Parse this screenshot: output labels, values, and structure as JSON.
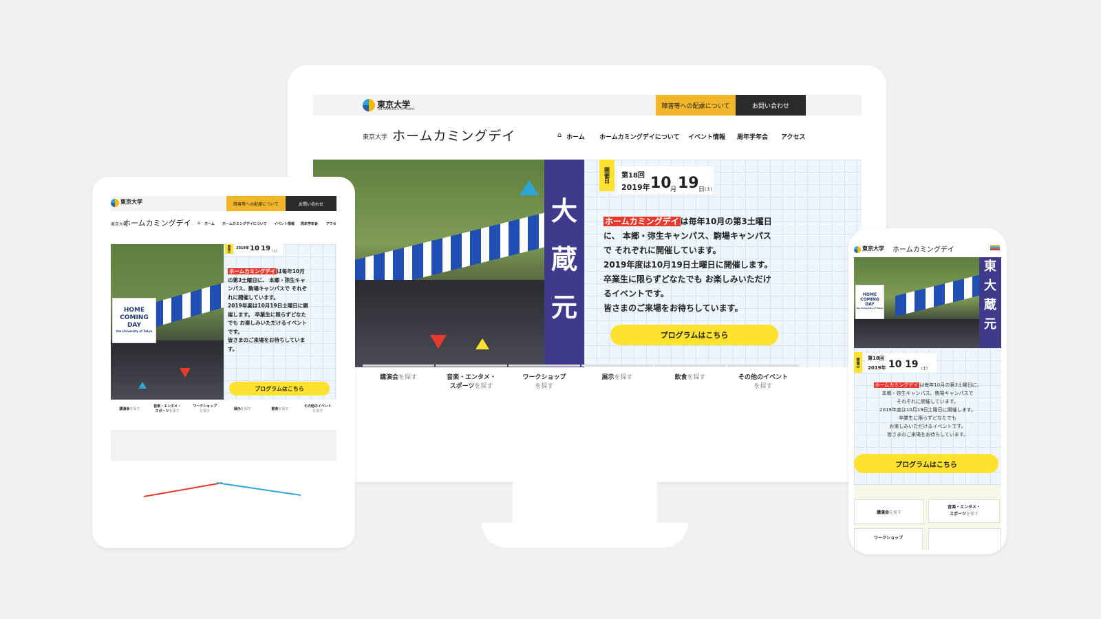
{
  "site": {
    "univ_logo": "東京大学",
    "univ_logo_sub": "THE UNIVERSITY OF TOKYO",
    "accessibility_button": "障害等への配慮について",
    "contact_button": "お問い合わせ",
    "site_prefix": "東京大学",
    "site_title": "ホームカミングデイ"
  },
  "nav": {
    "home": "ホーム",
    "about": "ホームカミングデイについて",
    "events": "イベント情報",
    "anniversary": "周年学年会",
    "access": "アクセス",
    "access_truncated": "アクセ"
  },
  "hero": {
    "badge": "開催日",
    "edition": "第18回",
    "year": "2019年",
    "month": "10",
    "month_unit": "月",
    "day": "19",
    "day_unit": "日",
    "weekday": "(土)",
    "highlight": "ホームカミングデイ",
    "desktop_lines": [
      "は毎年10月の第3土曜日",
      "に、 本郷・弥生キャンパス、駒場キャンパス",
      "で それぞれに開催しています。",
      "2019年度は10月19日土曜日に開催します。",
      "卒業生に限らずどなたでも お楽しみいただけ",
      "るイベントです。",
      "皆さまのご来場をお待ちしています。"
    ],
    "tablet_lines": [
      "は毎年10月",
      "の第3土曜日に、 本郷・弥生キャ",
      "ンパス、駒場キャンパスで それぞ",
      "れに開催しています。",
      "2019年度は10月19日土曜日に開",
      "催します。 卒業生に限らずどなた",
      "でも お楽しみいただけるイベント",
      "です。",
      "皆さまのご来場をお待ちしていま",
      "す。"
    ],
    "phone_lines": [
      "は毎年10月の第3土曜日に、",
      "本郷・弥生キャンパス、駒場キャンパスで",
      "それぞれに開催しています。",
      "2019年度は10月19日土曜日に開催します。",
      "卒業生に限らずどなたでも",
      "お楽しみいただけるイベントです。",
      "皆さまのご来場をお待ちしています。"
    ],
    "program_button": "プログラムはこちら",
    "banner_text": "大蔵元",
    "phone_banner_text": "東大蔵元"
  },
  "categories": [
    {
      "main": "講演会",
      "suffix": "を探す"
    },
    {
      "main": "音楽・エンタメ・",
      "main2": "スポーツ",
      "suffix": "を探す"
    },
    {
      "main": "ワークショップ",
      "suffix": "を探す"
    },
    {
      "main": "展示",
      "suffix": "を探す"
    },
    {
      "main": "飲食",
      "suffix": "を探す"
    },
    {
      "main": "その他のイベント",
      "suffix": "を探す"
    }
  ],
  "phone_categories": [
    {
      "main": "講演会",
      "suffix": "を探す"
    },
    {
      "main": "音楽・エンタメ・",
      "main2": "スポーツ",
      "suffix": "を探す"
    },
    {
      "main": "ワークショップ"
    }
  ],
  "homecoming_logo": {
    "line1": "HOME",
    "line2": "COMING",
    "line3": "DAY",
    "sub": "the University of Tokyo"
  },
  "colors": {
    "accent_yellow": "#ffe22e",
    "header_yellow": "#f2b62a",
    "highlight_red": "#e63a2e",
    "dark": "#2b2b2b",
    "tent_blue": "#1f4fb5"
  }
}
